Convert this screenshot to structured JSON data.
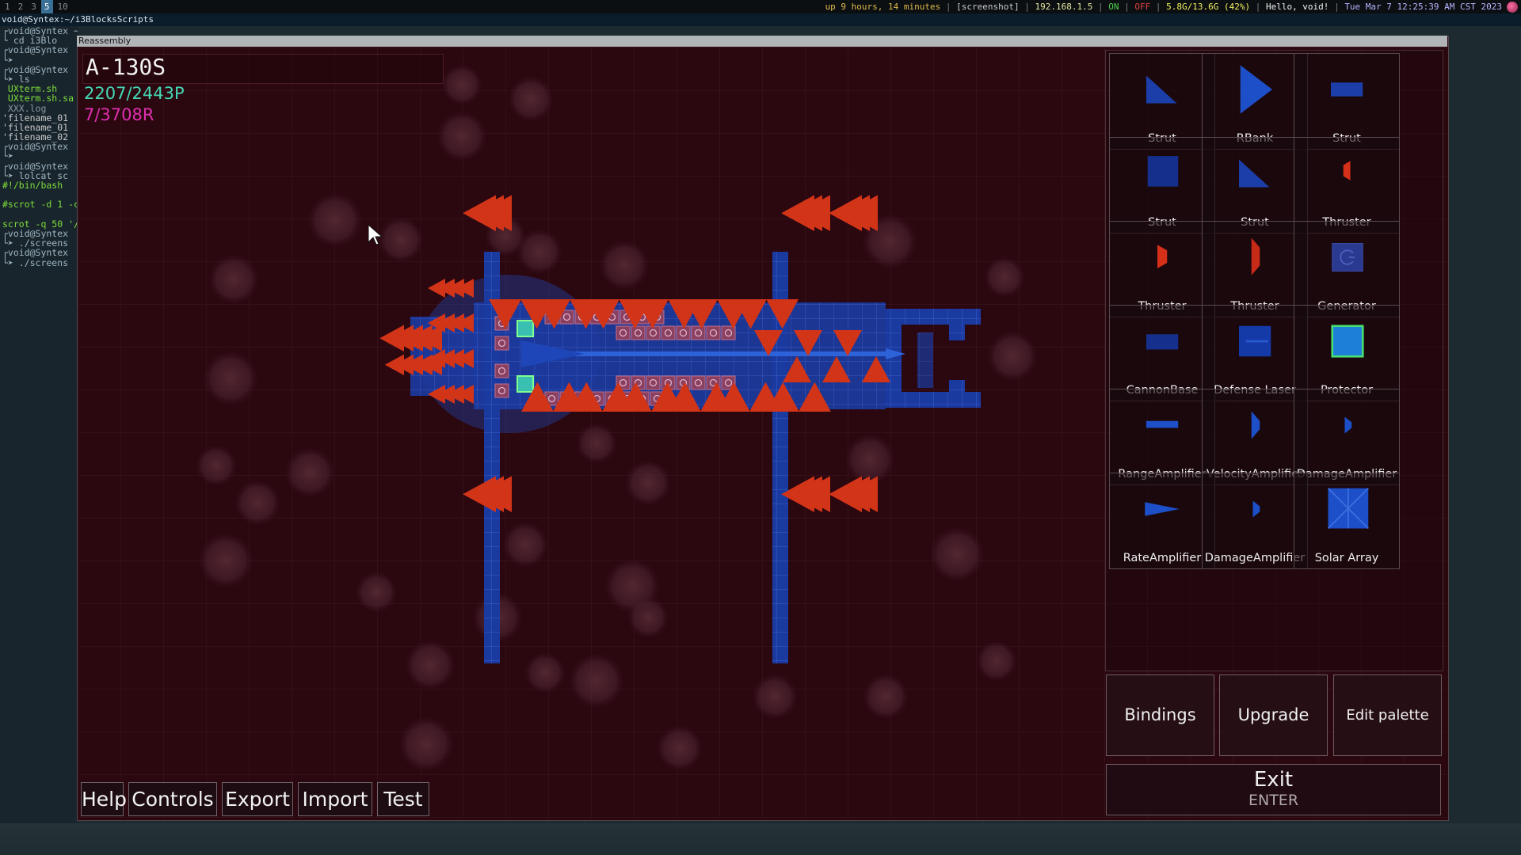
{
  "topbar": {
    "workspaces": [
      "1",
      "2",
      "3",
      "5",
      "10"
    ],
    "active_workspace": "5",
    "uptime": "up 9 hours, 14 minutes",
    "mode": "[screenshot]",
    "ip": "192.168.1.5",
    "net_on": "ON",
    "net_off": "OFF",
    "memory": "5.8G/13.6G (42%)",
    "greeting": "Hello, void!",
    "datetime": "Tue Mar  7 12:25:39 AM CST 2023"
  },
  "terminal": {
    "title": "void@Syntex:~/i3BlocksScripts",
    "lines": [
      {
        "text": "┌void@Syntex ~/",
        "cls": "t-prompt"
      },
      {
        "text": "└ cd i3Blo",
        "cls": "t-prompt"
      },
      {
        "text": "┌void@Syntex",
        "cls": "t-prompt"
      },
      {
        "text": "└➤",
        "cls": "t-prompt"
      },
      {
        "text": "┌void@Syntex",
        "cls": "t-prompt"
      },
      {
        "text": "└➤ ls",
        "cls": "t-prompt"
      },
      {
        "text": " UXterm.sh",
        "cls": "t-green"
      },
      {
        "text": " UXterm.sh.sa",
        "cls": "t-green"
      },
      {
        "text": " XXX.log",
        "cls": "t-dim"
      },
      {
        "text": "'filename_01",
        "cls": "t-file"
      },
      {
        "text": "'filename_01",
        "cls": "t-file"
      },
      {
        "text": "'filename_02",
        "cls": "t-file"
      },
      {
        "text": "┌void@Syntex",
        "cls": "t-prompt"
      },
      {
        "text": "└➤",
        "cls": "t-prompt"
      },
      {
        "text": "┌void@Syntex",
        "cls": "t-prompt"
      },
      {
        "text": "└➤ lolcat sc",
        "cls": "t-prompt"
      },
      {
        "text": "#!/bin/bash",
        "cls": "t-green"
      },
      {
        "text": "",
        "cls": "t-file"
      },
      {
        "text": "#scrot -d 1 -c",
        "cls": "t-green"
      },
      {
        "text": "",
        "cls": "t-file"
      },
      {
        "text": "scrot -q 50 '/",
        "cls": "t-green"
      },
      {
        "text": "┌void@Syntex",
        "cls": "t-prompt"
      },
      {
        "text": "└➤ ./screens",
        "cls": "t-prompt"
      },
      {
        "text": "┌void@Syntex",
        "cls": "t-prompt"
      },
      {
        "text": "└➤ ./screens",
        "cls": "t-prompt"
      }
    ]
  },
  "window_title": "Reassembly",
  "ship": {
    "name": "A-130S",
    "points": "2207/2443P",
    "resources": "7/3708R"
  },
  "palette": [
    {
      "label": "Strut",
      "icon": "triangle-strut-icon"
    },
    {
      "label": "RBank",
      "icon": "rbank-triangle-icon"
    },
    {
      "label": "Strut",
      "icon": "rect-strut-icon"
    },
    {
      "label": "Strut",
      "icon": "square-strut-icon"
    },
    {
      "label": "Strut",
      "icon": "triangle-strut-icon"
    },
    {
      "label": "Thruster",
      "icon": "small-thruster-icon"
    },
    {
      "label": "Thruster",
      "icon": "thruster-icon"
    },
    {
      "label": "Thruster",
      "icon": "tall-thruster-icon"
    },
    {
      "label": "Generator",
      "icon": "generator-icon"
    },
    {
      "label": "CannonBase",
      "icon": "cannon-base-icon"
    },
    {
      "label": "Defense Laser",
      "icon": "defense-laser-icon"
    },
    {
      "label": "Protector",
      "icon": "protector-icon"
    },
    {
      "label": "RangeAmplifier",
      "icon": "range-amplifier-icon"
    },
    {
      "label": "VelocityAmplifier",
      "icon": "velocity-amplifier-icon"
    },
    {
      "label": "DamageAmplifier",
      "icon": "damage-amplifier-icon"
    },
    {
      "label": "RateAmplifier",
      "icon": "rate-amplifier-icon"
    },
    {
      "label": "DamageAmplifier",
      "icon": "damage-amplifier-icon"
    },
    {
      "label": "Solar Array",
      "icon": "solar-array-icon"
    }
  ],
  "actions": {
    "bindings": "Bindings",
    "upgrade": "Upgrade",
    "edit_palette": "Edit palette",
    "exit": "Exit",
    "exit_key": "ENTER"
  },
  "bottom_buttons": [
    "Help",
    "Controls",
    "Export",
    "Import",
    "Test"
  ],
  "colors": {
    "background": "#2b0710",
    "block_blue": "#1a3fa8",
    "thruster_red": "#d9321a",
    "points_teal": "#45d9b5",
    "resources_magenta": "#e02fb0"
  }
}
